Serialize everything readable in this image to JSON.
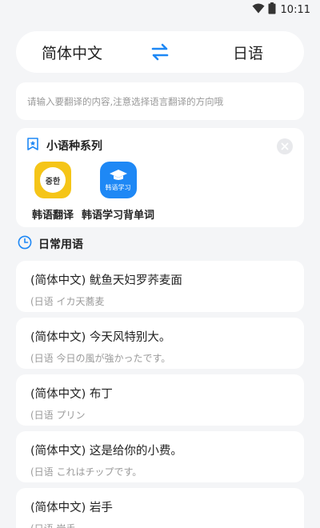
{
  "status_bar": {
    "time": "10:11",
    "icons": [
      "wifi-icon",
      "battery-icon"
    ]
  },
  "language_bar": {
    "source": "简体中文",
    "target": "日语",
    "swap_icon": "swap-arrows-icon"
  },
  "input": {
    "placeholder": "请输入要翻译的内容,注意选择语言翻译的方向哦"
  },
  "minor_languages": {
    "title": "小语种系列",
    "apps": [
      {
        "label": "韩语翻译",
        "icon_text": "중한",
        "color": "#f5c518"
      },
      {
        "label": "韩语学习背单词",
        "icon_text": "韩语学习",
        "color": "#1e88f5"
      }
    ]
  },
  "phrases": {
    "title": "日常用语",
    "items": [
      {
        "source": "(简体中文) 鱿鱼天妇罗荞麦面",
        "target": "(日语 イカ天蕎麦"
      },
      {
        "source": "(简体中文) 今天风特别大。",
        "target": "(日语 今日の風が強かったです。"
      },
      {
        "source": "(简体中文) 布丁",
        "target": "(日语 プリン"
      },
      {
        "source": "(简体中文) 这是给你的小费。",
        "target": "(日语 これはチップです。"
      },
      {
        "source": "(简体中文) 岩手",
        "target": "(日语 岩手"
      }
    ]
  },
  "colors": {
    "accent": "#1e88f5",
    "background": "#f4f5f7",
    "card": "#ffffff"
  }
}
